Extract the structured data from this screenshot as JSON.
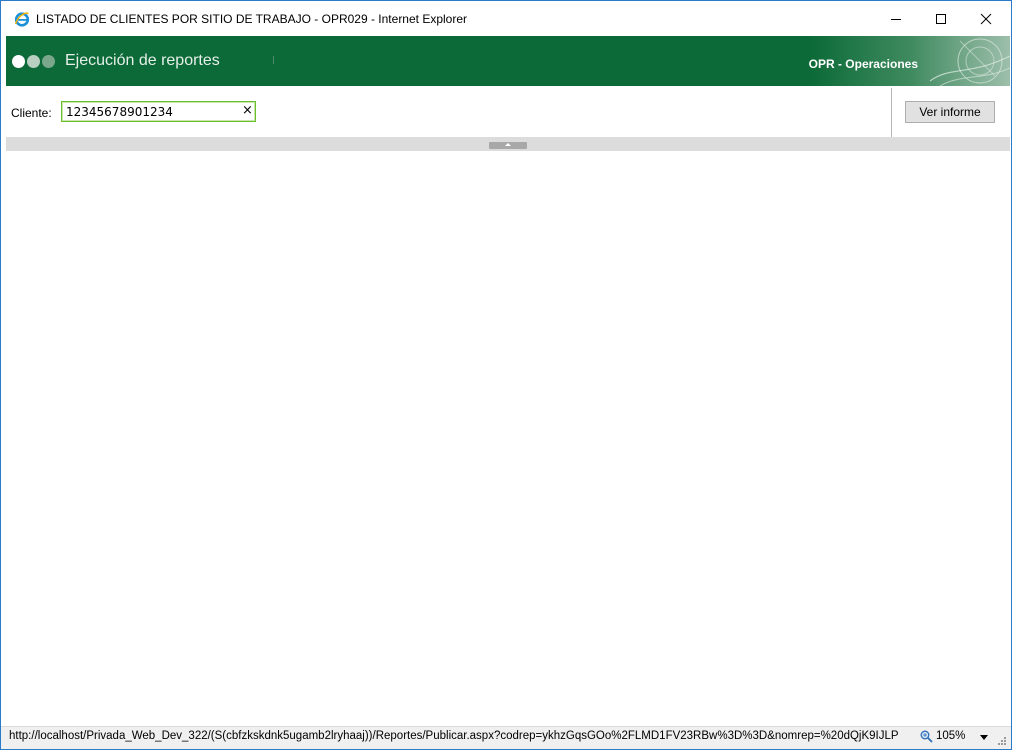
{
  "window": {
    "title": "LISTADO DE CLIENTES POR SITIO DE TRABAJO - OPR029 - Internet Explorer",
    "app_icon": "internet-explorer-icon",
    "controls": {
      "minimize": "minimize-icon",
      "maximize": "maximize-icon",
      "close": "close-icon"
    }
  },
  "banner": {
    "title": "Ejecución de reportes",
    "right_label": "OPR - Operaciones",
    "bg_color": "#0b6a37"
  },
  "params": {
    "cliente_label": "Cliente:",
    "cliente_value": "12345678901234",
    "clear_glyph": "×",
    "submit_label": "Ver informe",
    "focus_color": "#6bbf2e"
  },
  "statusbar": {
    "url": "http://localhost/Privada_Web_Dev_322/(S(cbfzkskdnk5ugamb2lryhaaj))/Reportes/Publicar.aspx?codrep=ykhzGqsGOo%2FLMD1FV23RBw%3D%3D&nomrep=%20dQjK9IJLP",
    "zoom": "105%",
    "zoom_icon": "zoom-magnifier-icon"
  }
}
